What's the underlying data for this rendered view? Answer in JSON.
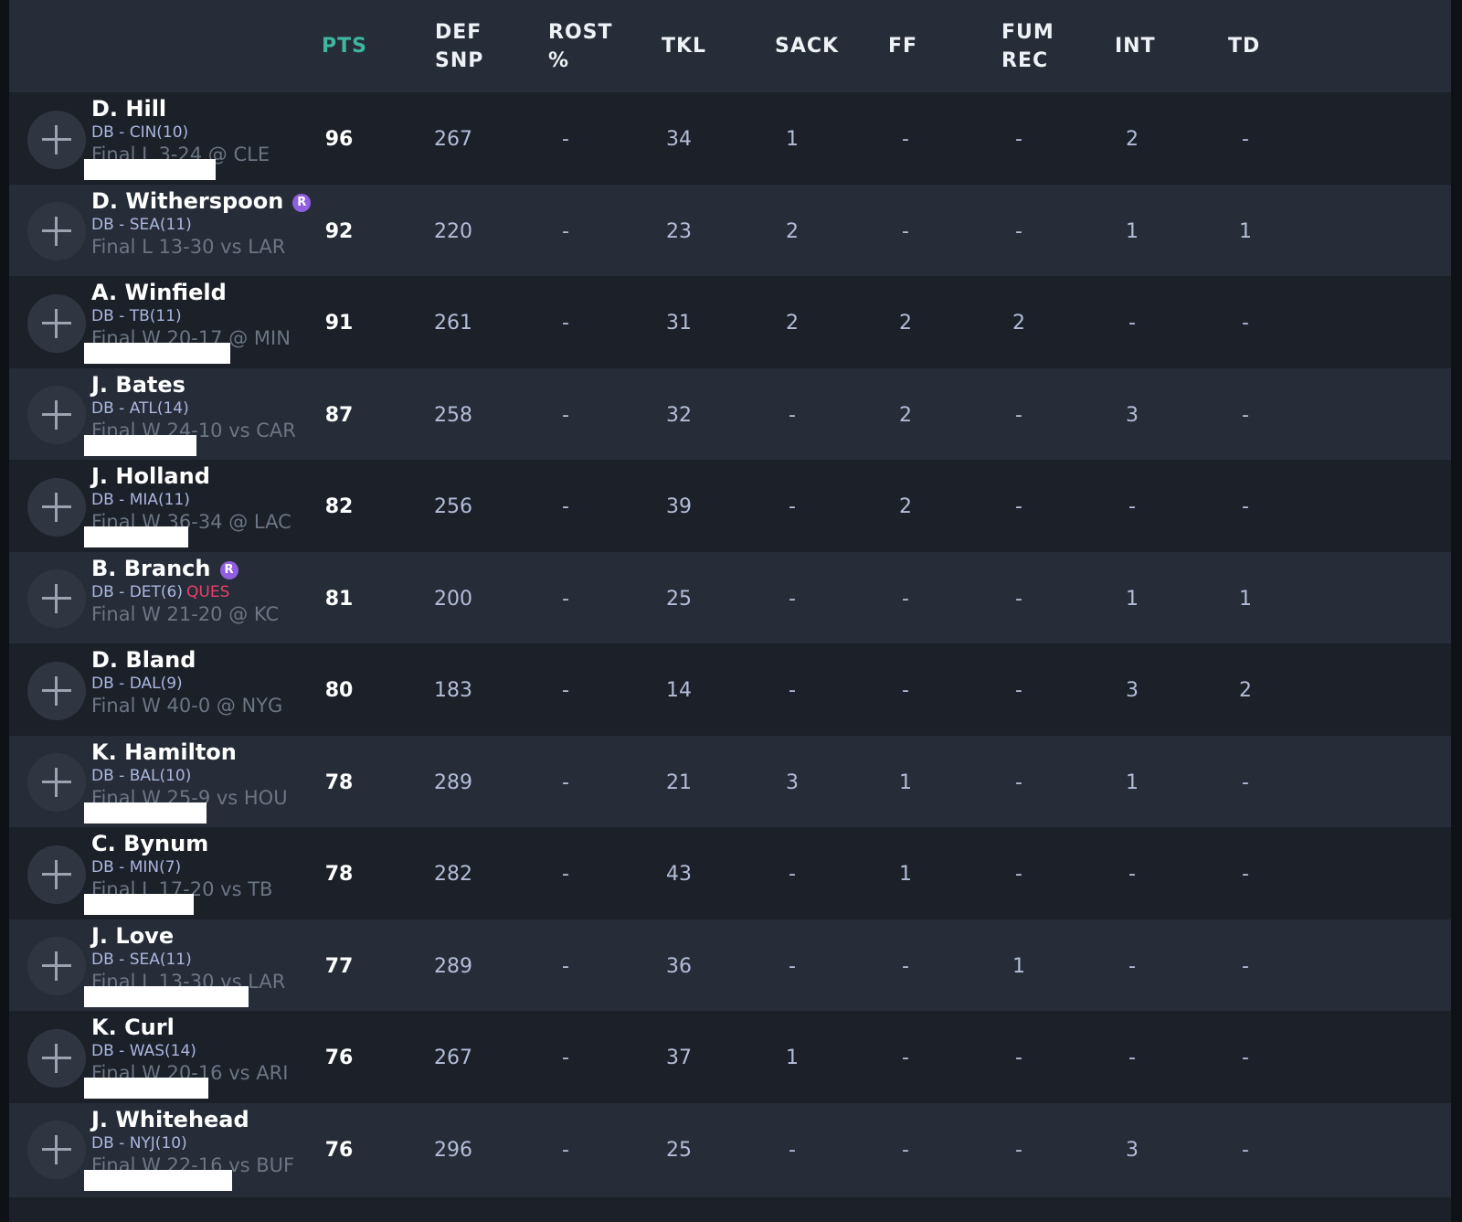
{
  "columns": [
    {
      "key": "pts",
      "label": "PTS"
    },
    {
      "key": "def_snp",
      "label": "DEF\nSNP"
    },
    {
      "key": "rost",
      "label": "ROST\n%"
    },
    {
      "key": "tkl",
      "label": "TKL"
    },
    {
      "key": "sack",
      "label": "SACK"
    },
    {
      "key": "ff",
      "label": "FF"
    },
    {
      "key": "fum_rec",
      "label": "FUM\nREC"
    },
    {
      "key": "int",
      "label": "INT"
    },
    {
      "key": "td",
      "label": "TD"
    }
  ],
  "add_icon": "plus-icon",
  "rookie_badge": "R",
  "colors": {
    "pts_header": "#3fb6a0",
    "status_ques": "#e8406a",
    "rookie_badge": "#8f5fe0"
  },
  "players": [
    {
      "name": "D. Hill",
      "rookie": false,
      "pos": "DB - CIN(10)",
      "status": "",
      "game": "Final L 3-24 @ CLE",
      "redacted": true,
      "stats": {
        "pts": "96",
        "def_snp": "267",
        "rost": "-",
        "tkl": "34",
        "sack": "1",
        "ff": "-",
        "fum_rec": "-",
        "int": "2",
        "td": "-"
      }
    },
    {
      "name": "D. Witherspoon",
      "rookie": true,
      "pos": "DB - SEA(11)",
      "status": "",
      "game": "Final L 13-30 vs LAR",
      "redacted": false,
      "stats": {
        "pts": "92",
        "def_snp": "220",
        "rost": "-",
        "tkl": "23",
        "sack": "2",
        "ff": "-",
        "fum_rec": "-",
        "int": "1",
        "td": "1"
      }
    },
    {
      "name": "A. Winfield",
      "rookie": false,
      "pos": "DB - TB(11)",
      "status": "",
      "game": "Final W 20-17 @ MIN",
      "redacted": true,
      "stats": {
        "pts": "91",
        "def_snp": "261",
        "rost": "-",
        "tkl": "31",
        "sack": "2",
        "ff": "2",
        "fum_rec": "2",
        "int": "-",
        "td": "-"
      }
    },
    {
      "name": "J. Bates",
      "rookie": false,
      "pos": "DB - ATL(14)",
      "status": "",
      "game": "Final W 24-10 vs CAR",
      "redacted": true,
      "stats": {
        "pts": "87",
        "def_snp": "258",
        "rost": "-",
        "tkl": "32",
        "sack": "-",
        "ff": "2",
        "fum_rec": "-",
        "int": "3",
        "td": "-"
      }
    },
    {
      "name": "J. Holland",
      "rookie": false,
      "pos": "DB - MIA(11)",
      "status": "",
      "game": "Final W 36-34 @ LAC",
      "redacted": true,
      "stats": {
        "pts": "82",
        "def_snp": "256",
        "rost": "-",
        "tkl": "39",
        "sack": "-",
        "ff": "2",
        "fum_rec": "-",
        "int": "-",
        "td": "-"
      }
    },
    {
      "name": "B. Branch",
      "rookie": true,
      "pos": "DB - DET(6)",
      "status": "QUES",
      "game": "Final W 21-20 @ KC",
      "redacted": false,
      "stats": {
        "pts": "81",
        "def_snp": "200",
        "rost": "-",
        "tkl": "25",
        "sack": "-",
        "ff": "-",
        "fum_rec": "-",
        "int": "1",
        "td": "1"
      }
    },
    {
      "name": "D. Bland",
      "rookie": false,
      "pos": "DB - DAL(9)",
      "status": "",
      "game": "Final W 40-0 @ NYG",
      "redacted": false,
      "stats": {
        "pts": "80",
        "def_snp": "183",
        "rost": "-",
        "tkl": "14",
        "sack": "-",
        "ff": "-",
        "fum_rec": "-",
        "int": "3",
        "td": "2"
      }
    },
    {
      "name": "K. Hamilton",
      "rookie": false,
      "pos": "DB - BAL(10)",
      "status": "",
      "game": "Final W 25-9 vs HOU",
      "redacted": true,
      "stats": {
        "pts": "78",
        "def_snp": "289",
        "rost": "-",
        "tkl": "21",
        "sack": "3",
        "ff": "1",
        "fum_rec": "-",
        "int": "1",
        "td": "-"
      }
    },
    {
      "name": "C. Bynum",
      "rookie": false,
      "pos": "DB - MIN(7)",
      "status": "",
      "game": "Final L 17-20 vs TB",
      "redacted": true,
      "stats": {
        "pts": "78",
        "def_snp": "282",
        "rost": "-",
        "tkl": "43",
        "sack": "-",
        "ff": "1",
        "fum_rec": "-",
        "int": "-",
        "td": "-"
      }
    },
    {
      "name": "J. Love",
      "rookie": false,
      "pos": "DB - SEA(11)",
      "status": "",
      "game": "Final L 13-30 vs LAR",
      "redacted": true,
      "stats": {
        "pts": "77",
        "def_snp": "289",
        "rost": "-",
        "tkl": "36",
        "sack": "-",
        "ff": "-",
        "fum_rec": "1",
        "int": "-",
        "td": "-"
      }
    },
    {
      "name": "K. Curl",
      "rookie": false,
      "pos": "DB - WAS(14)",
      "status": "",
      "game": "Final W 20-16 vs ARI",
      "redacted": true,
      "stats": {
        "pts": "76",
        "def_snp": "267",
        "rost": "-",
        "tkl": "37",
        "sack": "1",
        "ff": "-",
        "fum_rec": "-",
        "int": "-",
        "td": "-"
      }
    },
    {
      "name": "J. Whitehead",
      "rookie": false,
      "pos": "DB - NYJ(10)",
      "status": "",
      "game": "Final W 22-16 vs BUF",
      "redacted": true,
      "stats": {
        "pts": "76",
        "def_snp": "296",
        "rost": "-",
        "tkl": "25",
        "sack": "-",
        "ff": "-",
        "fum_rec": "-",
        "int": "3",
        "td": "-"
      }
    }
  ]
}
